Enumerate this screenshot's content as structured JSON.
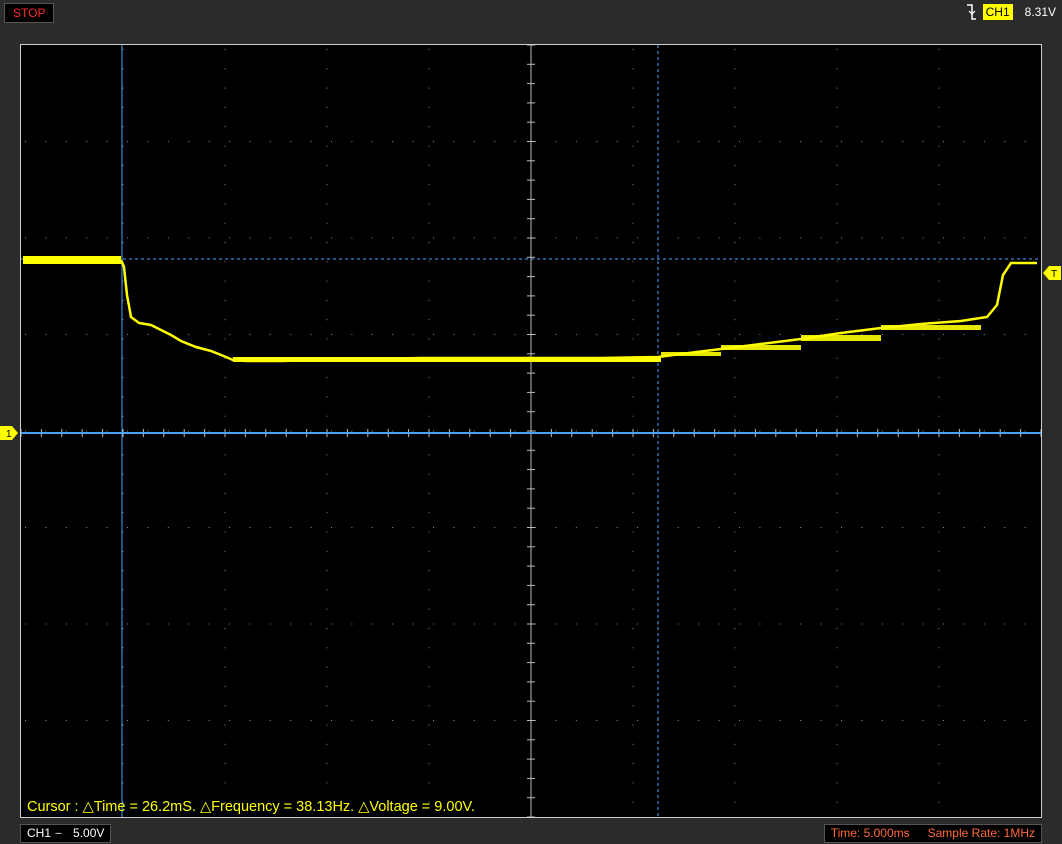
{
  "header": {
    "run_state": "STOP",
    "trigger_channel": "CH1",
    "trigger_level": "8.31V"
  },
  "screen": {
    "cursor_readout": "Cursor : △Time = 26.2mS. △Frequency = 38.13Hz. △Voltage = 9.00V.",
    "ground_marker": "1",
    "trigger_marker": "T"
  },
  "footer": {
    "channel": "CH1",
    "coupling": "---",
    "volts_per_div": "5.00V",
    "timebase": "Time: 5.000ms",
    "sample_rate": "Sample Rate: 1MHz"
  },
  "colors": {
    "trace": "#ffff00",
    "cursor": "#4aa3ff",
    "grid": "#8a8a8a",
    "stop": "#ff2a2a",
    "time_info": "#ff6a3a"
  },
  "icons": [
    "trigger-falling-edge-icon",
    "ground-marker-icon",
    "trigger-marker-icon"
  ]
}
